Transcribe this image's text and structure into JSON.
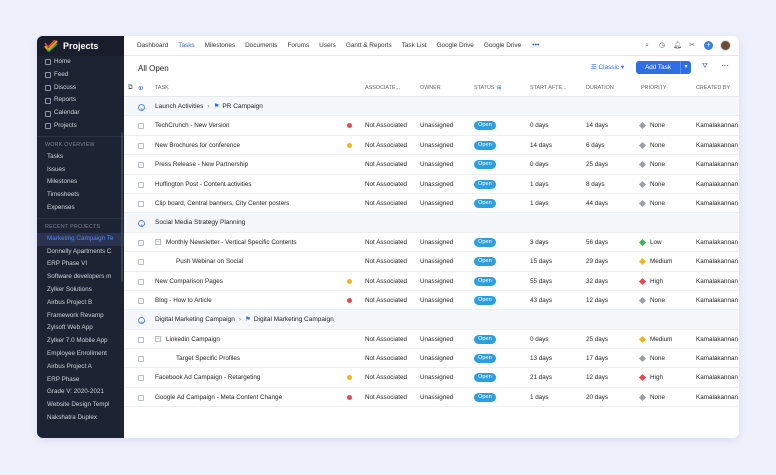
{
  "app": {
    "title": "Projects",
    "accent": "#2b6fe3",
    "sidebar_bg": "#1e2333"
  },
  "sidebar": {
    "main": [
      "Home",
      "Feed",
      "Discuss",
      "Reports",
      "Calendar",
      "Projects"
    ],
    "work_overview_label": "WORK OVERVIEW",
    "work_overview": [
      "Tasks",
      "Issues",
      "Milestones",
      "Timesheets",
      "Expenses"
    ],
    "recent_projects_label": "RECENT PROJECTS",
    "recent_projects": [
      "Marketing Campaign Te",
      "Donnelly Apartments C",
      "ERP Phase VI",
      "Software developers m",
      "Zylker Solutions",
      "Airbus Project B",
      "Framework Revamp",
      "Zylsoft Web App",
      "Zylker 7.0 Mobile App",
      "Employee Enrollment",
      "Airbus Project A",
      "ERP Phase",
      "Grade V: 2020-2021",
      "Website Design Templ",
      "Nakshatra Duplex"
    ]
  },
  "topnav": {
    "items": [
      "Dashboard",
      "Tasks",
      "Milestones",
      "Documents",
      "Forums",
      "Users",
      "Gantt & Reports",
      "Task List",
      "Google Drive",
      "Google Drive"
    ],
    "active": "Tasks",
    "more": "•••",
    "icons": [
      "search-icon",
      "timer-icon",
      "bell-icon",
      "settings-icon",
      "plus-icon",
      "avatar"
    ]
  },
  "toolbar": {
    "title": "All Open",
    "view_label": "Classic",
    "add_task_label": "Add Task"
  },
  "columns": [
    "TASK",
    "ASSOCIATE...",
    "OWNER",
    "STATUS",
    "START AFTE...",
    "DURATION",
    "PRIORITY",
    "CREATED BY"
  ],
  "groups": [
    {
      "title": "Launch Activities",
      "subtitle": "PR Campaign",
      "rows": [
        {
          "task": "TechCrunch - New Version",
          "dot": "#e34d4d",
          "assoc": "Not Associated",
          "owner": "Unassigned",
          "status": "Open",
          "start": "0 days",
          "duration": "14 days",
          "priority": "None",
          "pcolor": "#9aa0aa",
          "created": "Kamalakannan I"
        },
        {
          "task": "New Brochures for conference",
          "dot": "#f0b429",
          "assoc": "Not Associated",
          "owner": "Unassigned",
          "status": "Open",
          "start": "14 days",
          "duration": "6 days",
          "priority": "None",
          "pcolor": "#9aa0aa",
          "created": "Kamalakannan I"
        },
        {
          "task": "Press Release - New Partnership",
          "dot": "",
          "assoc": "Not Associated",
          "owner": "Unassigned",
          "status": "Open",
          "start": "0 days",
          "duration": "25 days",
          "priority": "None",
          "pcolor": "#9aa0aa",
          "created": "Kamalakannan I"
        },
        {
          "task": "Huffington Post - Content activities",
          "dot": "",
          "assoc": "Not Associated",
          "owner": "Unassigned",
          "status": "Open",
          "start": "1 days",
          "duration": "8 days",
          "priority": "None",
          "pcolor": "#9aa0aa",
          "created": "Kamalakannan I"
        },
        {
          "task": "Clip board, Central banners, City Center posters",
          "dot": "",
          "assoc": "Not Associated",
          "owner": "Unassigned",
          "status": "Open",
          "start": "1 days",
          "duration": "44 days",
          "priority": "None",
          "pcolor": "#9aa0aa",
          "created": "Kamalakannan I"
        }
      ]
    },
    {
      "title": "Social Media Strategy Planning",
      "subtitle": "",
      "rows": [
        {
          "task": "Monthly Newsletter - Vertical Specific Contents",
          "expand": "true",
          "dot": "",
          "assoc": "Not Associated",
          "owner": "Unassigned",
          "status": "Open",
          "start": "3 days",
          "duration": "56 days",
          "priority": "Low",
          "pcolor": "#3fb34f",
          "created": "Kamalakannan I"
        },
        {
          "task": "Push Webinar on Social",
          "sub": "true",
          "dot": "",
          "assoc": "Not Associated",
          "owner": "Unassigned",
          "status": "Open",
          "start": "15 days",
          "duration": "29 days",
          "priority": "Medium",
          "pcolor": "#f0b429",
          "created": "Kamalakannan I"
        },
        {
          "task": "New Comparison Pages",
          "dot": "#f0b429",
          "assoc": "Not Associated",
          "owner": "Unassigned",
          "status": "Open",
          "start": "55 days",
          "duration": "32 days",
          "priority": "High",
          "pcolor": "#e34d4d",
          "created": "Kamalakannan I"
        },
        {
          "task": "Blog - How to Article",
          "dot": "#e34d4d",
          "assoc": "Not Associated",
          "owner": "Unassigned",
          "status": "Open",
          "start": "43 days",
          "duration": "12 days",
          "priority": "None",
          "pcolor": "#9aa0aa",
          "created": "Kamalakannan I"
        }
      ]
    },
    {
      "title": "Digital Marketing Campaign",
      "subtitle": "Digital Marketing Campaign",
      "rows": [
        {
          "task": "Linkedin Campaign",
          "expand": "true",
          "dot": "",
          "assoc": "Not Associated",
          "owner": "Unassigned",
          "status": "Open",
          "start": "0 days",
          "duration": "25 days",
          "priority": "Medium",
          "pcolor": "#f0b429",
          "created": "Kamalakannan I"
        },
        {
          "task": "Target Specific Profiles",
          "sub": "true",
          "dot": "",
          "assoc": "Not Associated",
          "owner": "Unassigned",
          "status": "Open",
          "start": "13 days",
          "duration": "17 days",
          "priority": "None",
          "pcolor": "#9aa0aa",
          "created": "Kamalakannan I"
        },
        {
          "task": "Facebook Ad Campaign - Retargeting",
          "dot": "#f0b429",
          "assoc": "Not Associated",
          "owner": "Unassigned",
          "status": "Open",
          "start": "21 days",
          "duration": "12 days",
          "priority": "High",
          "pcolor": "#e34d4d",
          "created": "Kamalakannan I"
        },
        {
          "task": "Google Ad Campaign - Meta Content Change",
          "dot": "#e34d4d",
          "assoc": "Not Associated",
          "owner": "Unassigned",
          "status": "Open",
          "start": "1 days",
          "duration": "20 days",
          "priority": "None",
          "pcolor": "#9aa0aa",
          "created": "Kamalakannan I"
        }
      ]
    }
  ]
}
